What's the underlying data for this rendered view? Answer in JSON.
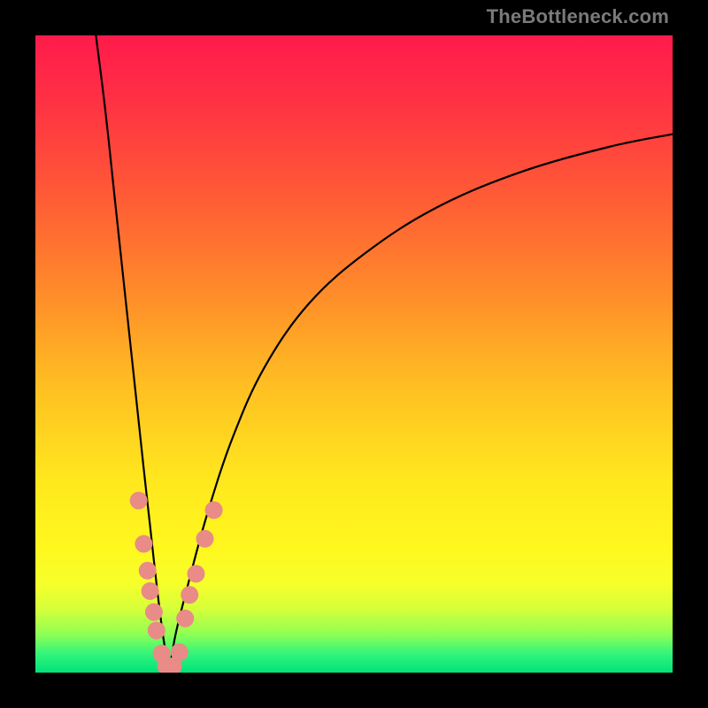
{
  "watermark": {
    "text": "TheBottleneck.com"
  },
  "gradient": {
    "stops": [
      {
        "offset": 0.0,
        "color": "#ff1b4b"
      },
      {
        "offset": 0.1,
        "color": "#ff3044"
      },
      {
        "offset": 0.25,
        "color": "#ff5a36"
      },
      {
        "offset": 0.4,
        "color": "#ff8a2a"
      },
      {
        "offset": 0.55,
        "color": "#ffbf22"
      },
      {
        "offset": 0.7,
        "color": "#ffe81e"
      },
      {
        "offset": 0.8,
        "color": "#fff71e"
      },
      {
        "offset": 0.86,
        "color": "#f6ff2a"
      },
      {
        "offset": 0.9,
        "color": "#d6ff3a"
      },
      {
        "offset": 0.94,
        "color": "#8fff55"
      },
      {
        "offset": 0.97,
        "color": "#34f57a"
      },
      {
        "offset": 1.0,
        "color": "#00e27a"
      }
    ]
  },
  "chart_data": {
    "type": "line",
    "title": "",
    "xlabel": "",
    "ylabel": "",
    "xlim": [
      0,
      100
    ],
    "ylim": [
      0,
      100
    ],
    "optimal_x": 21,
    "series": [
      {
        "name": "left-branch",
        "x": [
          9.5,
          11,
          12.5,
          14,
          15.5,
          17,
          18,
          19,
          20,
          21
        ],
        "y": [
          100,
          88,
          74,
          60,
          46,
          32,
          23,
          14,
          6,
          0
        ]
      },
      {
        "name": "right-branch",
        "x": [
          21,
          22,
          24,
          27,
          31,
          36,
          43,
          52,
          63,
          76,
          90,
          100
        ],
        "y": [
          0,
          6,
          14,
          25,
          37,
          48,
          58,
          66,
          73,
          78.5,
          82.5,
          84.5
        ]
      }
    ],
    "markers": {
      "name": "sample-points",
      "color": "#e98b86",
      "points": [
        {
          "x": 16.2,
          "y": 27.0,
          "r": 10
        },
        {
          "x": 17.0,
          "y": 20.2,
          "r": 10
        },
        {
          "x": 17.6,
          "y": 16.0,
          "r": 10
        },
        {
          "x": 18.0,
          "y": 12.8,
          "r": 10
        },
        {
          "x": 18.6,
          "y": 9.5,
          "r": 10
        },
        {
          "x": 19.0,
          "y": 6.6,
          "r": 10
        },
        {
          "x": 19.8,
          "y": 3.0,
          "r": 10
        },
        {
          "x": 20.5,
          "y": 1.0,
          "r": 10
        },
        {
          "x": 21.6,
          "y": 1.0,
          "r": 10
        },
        {
          "x": 22.6,
          "y": 3.2,
          "r": 10
        },
        {
          "x": 23.5,
          "y": 8.5,
          "r": 10
        },
        {
          "x": 24.2,
          "y": 12.2,
          "r": 10
        },
        {
          "x": 25.2,
          "y": 15.5,
          "r": 10
        },
        {
          "x": 26.6,
          "y": 21.0,
          "r": 10
        },
        {
          "x": 28.0,
          "y": 25.5,
          "r": 10
        }
      ]
    }
  }
}
